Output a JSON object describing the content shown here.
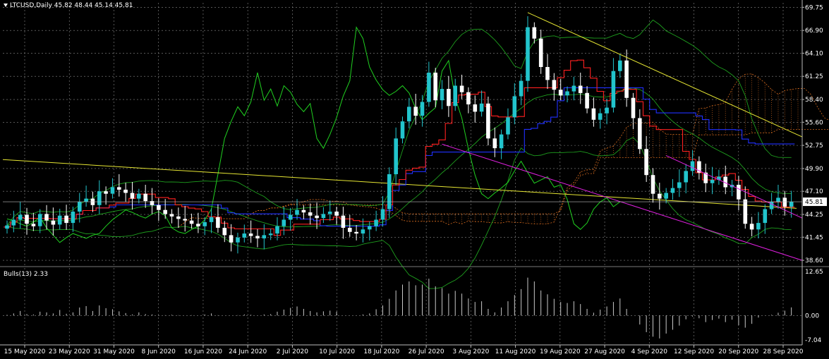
{
  "header": {
    "symbol": "LTCUSD,Daily",
    "ohlc": "45.82 48.44 45.14 45.81"
  },
  "indicator_label": "Bulls(13) 2.33",
  "current_price": "45.81",
  "colors": {
    "background": "#000000",
    "grid": "#8a8a8a",
    "bull_candle": "#22c4cc",
    "bear_candle": "#ffffff",
    "tenkan": "#ff2020",
    "kijun": "#2030ff",
    "chikou": "#20d020",
    "bollinger": "#1e9e1e",
    "kumo": "#d2691e",
    "trendline_upper": "#e6e633",
    "trendline_lower": "#e020e0",
    "long_ma": "#e6e633",
    "price_tag_bg": "#ffffff",
    "price_tag_fg": "#000000"
  },
  "chart_data": [
    {
      "type": "candlestick",
      "symbol": "LTCUSD",
      "timeframe": "Daily",
      "x_tick_labels": [
        "15 May 2020",
        "23 May 2020",
        "31 May 2020",
        "8 Jun 2020",
        "16 Jun 2020",
        "24 Jun 2020",
        "2 Jul 2020",
        "10 Jul 2020",
        "18 Jul 2020",
        "26 Jul 2020",
        "3 Aug 2020",
        "11 Aug 2020",
        "19 Aug 2020",
        "27 Aug 2020",
        "4 Sep 2020",
        "12 Sep 2020",
        "20 Sep 2020",
        "28 Sep 2020"
      ],
      "y_tick_labels": [
        "69.75",
        "66.90",
        "64.10",
        "61.25",
        "58.40",
        "55.60",
        "52.75",
        "49.90",
        "47.10",
        "44.25",
        "41.45",
        "38.60"
      ],
      "ylim": [
        38.0,
        70.3
      ],
      "close": [
        42.9,
        43.6,
        44.2,
        43.1,
        42.8,
        44.3,
        43.5,
        43.0,
        44.1,
        43.2,
        44.6,
        45.8,
        46.2,
        45.4,
        47.1,
        46.8,
        47.6,
        47.3,
        46.9,
        46.2,
        46.8,
        45.9,
        45.4,
        44.8,
        44.3,
        44.0,
        43.7,
        43.5,
        43.1,
        42.8,
        43.3,
        43.9,
        42.6,
        41.7,
        40.8,
        41.4,
        41.9,
        41.6,
        41.3,
        41.7,
        41.9,
        42.8,
        43.6,
        44.2,
        44.8,
        44.5,
        44.1,
        43.8,
        44.3,
        44.6,
        44.1,
        42.6,
        42.1,
        41.9,
        42.4,
        42.8,
        43.6,
        44.9,
        49.2,
        53.6,
        55.7,
        57.5,
        56.4,
        58.1,
        61.7,
        58.3,
        59.7,
        57.6,
        60.1,
        59.3,
        57.8,
        56.9,
        57.9,
        53.6,
        52.4,
        54.1,
        56.2,
        58.8,
        60.7,
        67.3,
        65.9,
        62.4,
        60.8,
        59.6,
        58.9,
        59.4,
        60.1,
        59.2,
        57.3,
        55.9,
        56.7,
        57.4,
        61.9,
        63.2,
        58.6,
        56.1,
        52.3,
        49.1,
        46.8,
        46.2,
        46.9,
        47.5,
        48.2,
        49.6,
        50.8,
        49.4,
        48.1,
        48.5,
        48.9,
        47.6,
        47.9,
        46.1,
        43.1,
        42.4,
        43.2,
        44.9,
        45.8,
        46.3,
        45.2,
        45.81
      ],
      "long_ma": {
        "start": 51.0,
        "end": 45.0
      },
      "indicator": {
        "name": "Bulls(13)",
        "value": 2.33,
        "ylim": [
          -7.04,
          12.65
        ],
        "y_tick_labels": [
          "12.65",
          "0.00",
          "-7.04"
        ],
        "values": [
          0.2,
          0.6,
          1.3,
          0.4,
          0.3,
          1.1,
          0.9,
          0.6,
          1.6,
          0.5,
          0.9,
          2.3,
          2.7,
          1.3,
          2.9,
          2.1,
          1.8,
          1.2,
          0.7,
          0.3,
          0.9,
          0.4,
          0.3,
          0.1,
          0.1,
          0.2,
          0.1,
          0.0,
          0.1,
          0.0,
          0.3,
          0.6,
          0.1,
          0.0,
          0.0,
          0.1,
          0.3,
          0.2,
          0.0,
          0.3,
          0.4,
          1.1,
          1.7,
          2.2,
          2.6,
          1.9,
          1.3,
          0.9,
          1.2,
          1.4,
          1.1,
          0.0,
          0.0,
          0.0,
          0.3,
          0.6,
          1.8,
          2.9,
          4.8,
          7.2,
          8.9,
          9.8,
          8.7,
          8.9,
          10.6,
          8.4,
          7.9,
          6.3,
          7.1,
          6.3,
          4.9,
          3.9,
          4.1,
          1.9,
          0.9,
          2.3,
          4.1,
          5.9,
          7.6,
          10.9,
          9.8,
          7.2,
          6.1,
          4.8,
          3.9,
          3.6,
          4.1,
          3.3,
          1.9,
          0.8,
          1.7,
          2.6,
          3.9,
          4.9,
          1.9,
          0.0,
          -2.6,
          -4.8,
          -6.1,
          -6.6,
          -5.2,
          -4.1,
          -2.9,
          -1.1,
          -0.3,
          -0.8,
          -1.9,
          -1.3,
          -0.9,
          -1.9,
          -1.2,
          -2.8,
          -3.5,
          -2.4,
          -0.6,
          0.0,
          0.2,
          0.8,
          1.4,
          2.33
        ]
      }
    }
  ]
}
